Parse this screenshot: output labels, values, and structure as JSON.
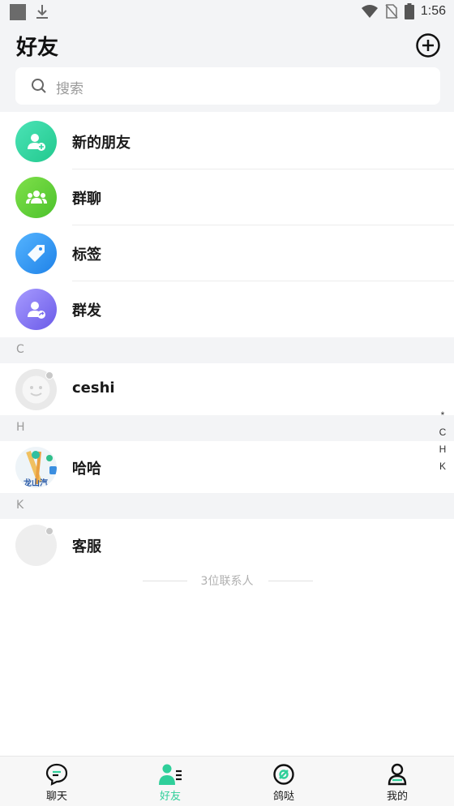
{
  "status_bar": {
    "time": "1:56"
  },
  "header": {
    "title": "好友",
    "add_icon": "plus-circle-icon"
  },
  "search": {
    "placeholder": "搜索"
  },
  "menu": [
    {
      "label": "新的朋友",
      "icon": "add-friend-icon",
      "color": "#2fd6a0"
    },
    {
      "label": "群聊",
      "icon": "group-chat-icon",
      "color": "#5fcf3a"
    },
    {
      "label": "标签",
      "icon": "tag-icon",
      "color": "#2f8ff0"
    },
    {
      "label": "群发",
      "icon": "broadcast-icon",
      "color": "#7a6cf0"
    }
  ],
  "sections": [
    {
      "letter": "C",
      "contacts": [
        {
          "name": "ceshi"
        }
      ]
    },
    {
      "letter": "H",
      "contacts": [
        {
          "name": "哈哈",
          "avatar_text": "龙山汽"
        }
      ]
    },
    {
      "letter": "K",
      "contacts": [
        {
          "name": "客服"
        }
      ]
    }
  ],
  "index_bar": [
    "*",
    "C",
    "H",
    "K"
  ],
  "contact_count": "3位联系人",
  "tabs": [
    {
      "label": "聊天",
      "icon": "chat-icon",
      "active": false
    },
    {
      "label": "好友",
      "icon": "friends-icon",
      "active": true
    },
    {
      "label": "鸽哒",
      "icon": "discover-icon",
      "active": false
    },
    {
      "label": "我的",
      "icon": "profile-icon",
      "active": false
    }
  ],
  "colors": {
    "accent": "#2fcf9a",
    "background": "#f3f4f6"
  }
}
